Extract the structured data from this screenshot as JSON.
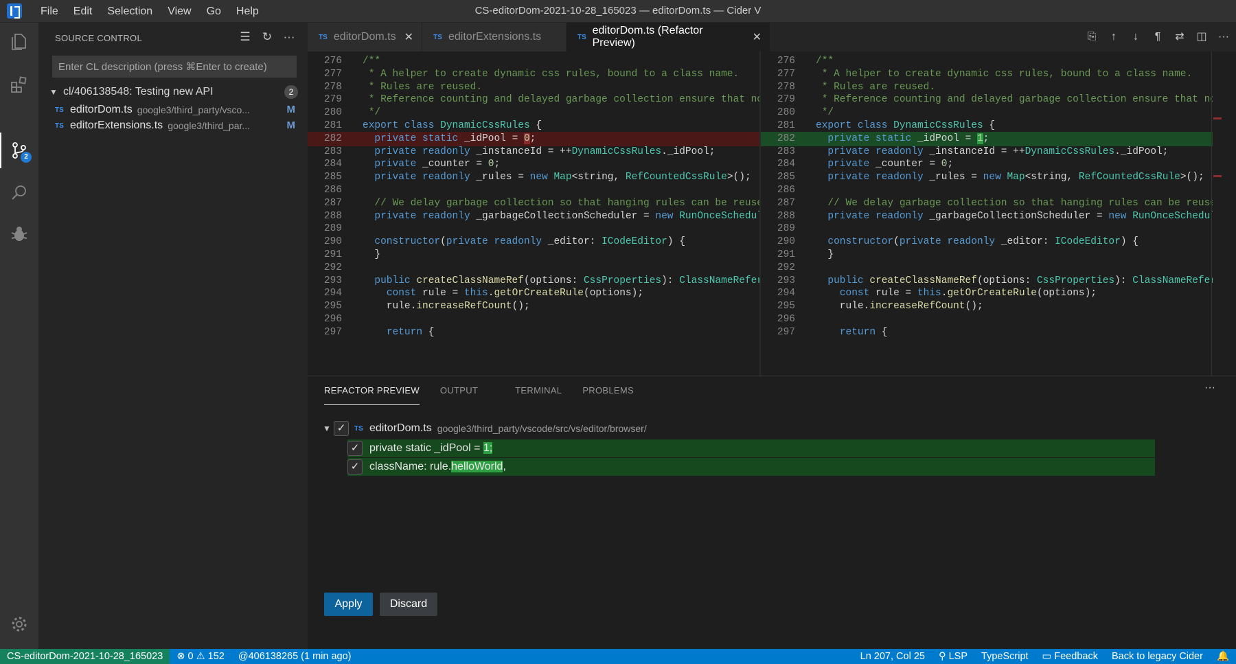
{
  "window": {
    "title": "CS-editorDom-2021-10-28_165023 — editorDom.ts — Cider V",
    "menu": [
      "File",
      "Edit",
      "Selection",
      "View",
      "Go",
      "Help"
    ]
  },
  "activity_bar": {
    "scm_badge": "2",
    "icons": [
      "files-icon",
      "extensions-icon",
      "source-control-icon",
      "search-icon",
      "debug-icon",
      "gear-icon"
    ]
  },
  "sidebar": {
    "title": "SOURCE CONTROL",
    "cl_placeholder": "Enter CL description (press ⌘Enter to create)",
    "cl": {
      "title": "cl/406138548: Testing new API",
      "count": "2"
    },
    "files": [
      {
        "icon": "TS",
        "name": "editorDom.ts",
        "path": "google3/third_party/vsco...",
        "status": "M"
      },
      {
        "icon": "TS",
        "name": "editorExtensions.ts",
        "path": "google3/third_par...",
        "status": "M"
      }
    ]
  },
  "tabs": [
    {
      "icon": "TS",
      "label": "editorDom.ts",
      "close": "✕"
    },
    {
      "icon": "TS",
      "label": "editorExtensions.ts",
      "close": ""
    },
    {
      "icon": "TS",
      "label": "editorDom.ts (Refactor Preview)",
      "close": "✕"
    }
  ],
  "diff": {
    "line_numbers": [
      "276",
      "277",
      "278",
      "279",
      "280",
      "281",
      "282",
      "283",
      "284",
      "285",
      "286",
      "287",
      "288",
      "289",
      "290",
      "291",
      "292",
      "293",
      "294",
      "295",
      "296",
      "297"
    ],
    "left": {
      "removed_value": "0",
      "lines": [
        "/**",
        " * A helper to create dynamic css rules, bound to a class name.",
        " * Rules are reused.",
        " * Reference counting and delayed garbage collection ensure that no",
        " */",
        "export class DynamicCssRules {",
        "  private static _idPool = ",
        "  private readonly _instanceId = ++DynamicCssRules._idPool;",
        "  private _counter = 0;",
        "  private readonly _rules = new Map<string, RefCountedCssRule>();",
        "",
        "  // We delay garbage collection so that hanging rules can be reuse",
        "  private readonly _garbageCollectionScheduler = new RunOnceSchedul",
        "",
        "  constructor(private readonly _editor: ICodeEditor) {",
        "  }",
        "",
        "  public createClassNameRef(options: CssProperties): ClassNameRefer",
        "    const rule = this.getOrCreateRule(options);",
        "    rule.increaseRefCount();",
        "",
        "    return {"
      ]
    },
    "right": {
      "added_value": "1",
      "lines": [
        "/**",
        " * A helper to create dynamic css rules, bound to a class name.",
        " * Rules are reused.",
        " * Reference counting and delayed garbage collection ensure that no",
        " */",
        "export class DynamicCssRules {",
        "  private static _idPool = ",
        "  private readonly _instanceId = ++DynamicCssRules._idPool;",
        "  private _counter = 0;",
        "  private readonly _rules = new Map<string, RefCountedCssRule>();",
        "",
        "  // We delay garbage collection so that hanging rules can be reuse",
        "  private readonly _garbageCollectionScheduler = new RunOnceSchedul",
        "",
        "  constructor(private readonly _editor: ICodeEditor) {",
        "  }",
        "",
        "  public createClassNameRef(options: CssProperties): ClassNameRefer",
        "    const rule = this.getOrCreateRule(options);",
        "    rule.increaseRefCount();",
        "",
        "    return {"
      ]
    }
  },
  "panel": {
    "tabs": [
      "REFACTOR PREVIEW",
      "OUTPUT",
      "TERMINAL",
      "PROBLEMS"
    ],
    "more": "···",
    "file": {
      "icon": "TS",
      "name": "editorDom.ts",
      "path": "google3/third_party/vscode/src/vs/editor/browser/"
    },
    "edits": [
      {
        "prefix": "private static _idPool = ",
        "highlight": "1;",
        "suffix": ""
      },
      {
        "prefix": "className: rule.",
        "highlight": "helloWorld",
        "suffix": ","
      }
    ],
    "apply_label": "Apply",
    "discard_label": "Discard"
  },
  "statusbar": {
    "branch": "CS-editorDom-2021-10-28_165023",
    "errors": "0",
    "warnings": "152",
    "cl_info": "@406138265 (1 min ago)",
    "cursor": "Ln 207, Col 25",
    "lsp": "LSP",
    "language": "TypeScript",
    "feedback": "Feedback",
    "legacy": "Back to legacy Cider"
  },
  "colors": {
    "accent": "#007acc",
    "removed_line": "#4b1818",
    "added_line": "#1a4d26",
    "branch_bg": "#16825d"
  }
}
